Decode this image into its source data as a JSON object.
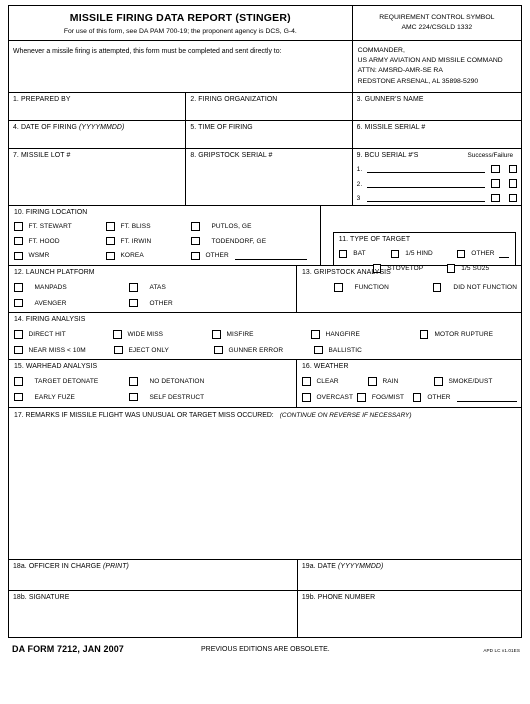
{
  "header": {
    "title": "MISSILE FIRING DATA REPORT (STINGER)",
    "subtitle": "For use of this form, see DA PAM 700-19; the proponent agency is DCS, G-4.",
    "rcs_label": "REQUIREMENT CONTROL SYMBOL",
    "rcs_value": "AMC 224/CSGLD 1332",
    "instruction": "Whenever a missile firing is attempted, this form must be completed and sent directly to:",
    "address": {
      "line1": "COMMANDER,",
      "line2": "US ARMY AVIATION AND MISSILE COMMAND",
      "line3": "ATTN:  AMSRD-AMR-SE RA",
      "line4": "REDSTONE ARSENAL, AL 35898-5290"
    }
  },
  "fields": {
    "f1": "1.  PREPARED BY",
    "f2": "2.  FIRING ORGANIZATION",
    "f3": "3.  GUNNER'S NAME",
    "f4_a": "4.  DATE OF FIRING ",
    "f4_b": "(YYYYMMDD)",
    "f5": "5.  TIME OF FIRING",
    "f6": "6.  MISSILE SERIAL #",
    "f7": "7.  MISSILE LOT #",
    "f8": "8.  GRIPSTOCK SERIAL #"
  },
  "bcu": {
    "title": "9.  BCU SERIAL #'S",
    "success_failure": "Success/Failure",
    "rows": [
      "1.",
      "2.",
      "3"
    ]
  },
  "firing_location": {
    "title": "10.  FIRING LOCATION",
    "options": [
      "FT. STEWART",
      "FT. BLISS",
      "PUTLOS, GE",
      "FT. HOOD",
      "FT. IRWIN",
      "TODENDORF, GE",
      "WSMR",
      "KOREA",
      "OTHER"
    ]
  },
  "type_of_target": {
    "title": "11.  TYPE OF TARGET",
    "row1": [
      "BAT",
      "1/5 HIND",
      "OTHER"
    ],
    "row2": [
      "STOVETOP",
      "1/5 SU25"
    ]
  },
  "launch_platform": {
    "title": "12.  LAUNCH PLATFORM",
    "row1": [
      "MANPADS",
      "ATAS"
    ],
    "row2": [
      "AVENGER",
      "OTHER"
    ]
  },
  "gripstock_analysis": {
    "title": "13.  GRIPSTOCK ANALYSIS",
    "options": [
      "FUNCTION",
      "DID NOT FUNCTION"
    ]
  },
  "firing_analysis": {
    "title": "14.  FIRING ANALYSIS",
    "row1": [
      "DIRECT HIT",
      "WIDE MISS",
      "MISFIRE",
      "HANGFIRE",
      "MOTOR RUPTURE"
    ],
    "row2": [
      "NEAR MISS < 10M",
      "EJECT ONLY",
      "GUNNER ERROR",
      "BALLISTIC"
    ]
  },
  "warhead_analysis": {
    "title": "15.  WARHEAD ANALYSIS",
    "row1": [
      "TARGET DETONATE",
      "NO DETONATION"
    ],
    "row2": [
      "EARLY FUZE",
      "SELF DESTRUCT"
    ]
  },
  "weather": {
    "title": "16.  WEATHER",
    "row1": [
      "CLEAR",
      "RAIN",
      "SMOKE/DUST"
    ],
    "row2": [
      "OVERCAST",
      "FOG/MIST",
      "OTHER"
    ]
  },
  "remarks": {
    "title": "17.  REMARKS IF MISSILE FLIGHT WAS UNUSUAL OR TARGET MISS OCCURED:",
    "note": "(CONTINUE ON REVERSE IF NECESSARY)"
  },
  "signature": {
    "f18a_a": "18a.  OFFICER IN CHARGE ",
    "f18a_b": "(PRINT)",
    "f19a_a": "19a.  DATE ",
    "f19a_b": "(YYYYMMDD)",
    "f18b": "18b.  SIGNATURE",
    "f19b": "19b.  PHONE NUMBER"
  },
  "footer": {
    "form_id": "DA FORM 7212, JAN 2007",
    "previous": "PREVIOUS EDITIONS ARE OBSOLETE.",
    "apd": "APD LC v1.01ES"
  }
}
